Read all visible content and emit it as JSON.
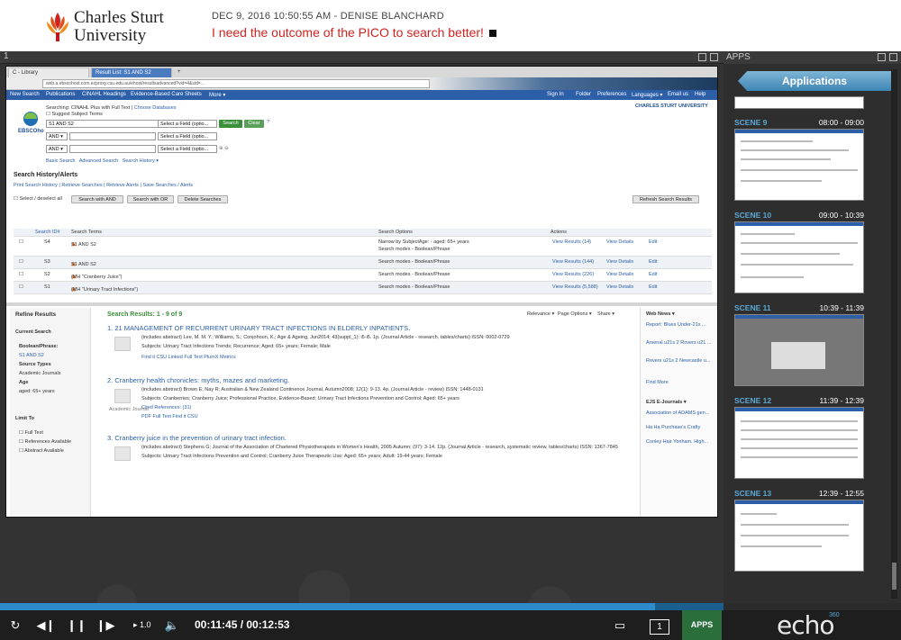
{
  "header": {
    "logo_line1": "Charles Sturt",
    "logo_line2": "University",
    "meta": "DEC 9, 2016 10:50:55 AM - DENISE BLANCHARD",
    "message": "I need the outcome of the PICO to search better!"
  },
  "stage": {
    "number": "1",
    "browser": {
      "tabs": [
        "C - Library",
        "Result List: S1 AND S2",
        "+"
      ],
      "address": "web.a.ebscohost.com.ezproxy.csu.edu.au/ehost/resultsadvanced?vid=4&sid=..."
    },
    "ebsco_nav": [
      "New Search",
      "Publications",
      "CINAHL Headings",
      "Evidence-Based Care Sheets",
      "More ▾"
    ],
    "ebsco_nav_right": [
      "Sign In",
      "Folder",
      "Preferences",
      "Languages ▾",
      "Email us",
      "Help"
    ],
    "searching_label": "Searching: CINAHL Plus with Full Text",
    "choose_databases": "Choose Databases",
    "suggest": "Suggest Subject Terms",
    "institution": "CHARLES STURT UNIVERSITY",
    "query1": "S1 AND S2",
    "field_placeholder": "Select a Field (optio...",
    "and_op": "AND ▾",
    "search_btn": "Search",
    "clear_btn": "Clear",
    "basic_search": "Basic Search",
    "advanced_search": "Advanced Search",
    "search_history": "Search History ▾",
    "history_title": "Search History/Alerts",
    "history_links": [
      "Print Search History",
      "Retrieve Searches",
      "Retrieve Alerts",
      "Save Searches / Alerts"
    ],
    "select_all": "Select / deselect all",
    "hist_buttons": [
      "Search with AND",
      "Search with OR",
      "Delete Searches",
      "Refresh Search Results"
    ],
    "hist_headers": [
      "Search ID#",
      "Search Terms",
      "Search Options",
      "Actions"
    ],
    "hist_rows": [
      {
        "id": "S4",
        "terms": "S1 AND S2",
        "options": "Narrow by SubjectAge: - aged: 65+ years",
        "options2": "Search modes - Boolean/Phrase",
        "count": "View Results (14)"
      },
      {
        "id": "S3",
        "terms": "S1 AND S2",
        "options": "Search modes - Boolean/Phrase",
        "options2": "",
        "count": "View Results (144)"
      },
      {
        "id": "S2",
        "terms": "(MH \"Cranberry Juice\")",
        "options": "Search modes - Boolean/Phrase",
        "options2": "",
        "count": "View Results (226)"
      },
      {
        "id": "S1",
        "terms": "(MH \"Urinary Tract Infections\")",
        "options": "Search modes - Boolean/Phrase",
        "options2": "",
        "count": "View Results (5,588)"
      }
    ],
    "view_details": "View Details",
    "edit": "Edit",
    "refine": {
      "title": "Refine Results",
      "current": "Current Search",
      "boolean": "Boolean/Phrase:",
      "query": "S1 AND S2",
      "source_types": "Source Types",
      "academic": "Academic Journals",
      "age": "Age",
      "aged": "aged: 65+ years",
      "limit": "Limit To",
      "full_text": "Full Text",
      "refs": "References Available",
      "abstract": "Abstract Available"
    },
    "results_heading": "Search Results: 1 - 9 of 9",
    "results_tools": [
      "Relevance ▾",
      "Page Options ▾",
      "Share ▾"
    ],
    "results": [
      {
        "num": "1.",
        "title": "21 MANAGEMENT OF RECURRENT URINARY TRACT INFECTIONS IN ELDERLY INPATIENTS.",
        "line1": "(includes abstract) Lee, M. M. Y.; Williams, S.; Conjohoun, K.; Age & Ageing, Jun2014; 43(suppl_1): i5-i5. 1p. (Journal Article - research, tables/charts) ISSN: 0002-0729",
        "line2": "Subjects: Urinary Tract Infections Trends; Recurrence; Aged: 65+ years; Female; Male",
        "links": "Find it CSU    Linked Full Text    PlumX Metrics"
      },
      {
        "num": "2.",
        "title": "Cranberry health chronicles: myths, mazes and marketing.",
        "line1": "(includes abstract) Brown E; Nay R; Australian & New Zealand Continence Journal, Autumn2008; 12(1): 9-13. 4p. (Journal Article - review) ISSN: 1448-0131",
        "line2": "Subjects: Cranberries; Cranberry Juice; Professional Practice, Evidence-Based; Urinary Tract Infections Prevention and Control; Aged: 65+ years",
        "links": "PDF Full Text    Find it CSU"
      },
      {
        "num": "3.",
        "title": "Cranberry juice in the prevention of urinary tract infection.",
        "line1": "(includes abstract) Stephens G; Journal of the Association of Chartered Physiotherapists in Women's Health, 2005 Autumn; (97): 3-14. 12p. (Journal Article - research, systematic review, tables/charts) ISSN: 1367-7845",
        "line2": "Subjects: Urinary Tract Infections Prevention and Control; Cranberry Juice Therapeutic Use; Aged: 65+ years; Adult: 19-44 years; Female",
        "links": ""
      }
    ],
    "cited_refs": "Cited References: (31)",
    "academic_journal": "Academic Journal",
    "web_news": "Web News ▾",
    "news": [
      "Report: Blues Under-21s ...",
      "Arsenal u21s 2 Rovers u21 ...",
      "Rovers u21s 2 Newcastle u...",
      "Find More"
    ],
    "ejs": "EJS E-Journals ▾",
    "ejs_items": [
      "Association of ADAMS gen...",
      "Ha Ha Purchase's Crafty",
      "Conley Hair Yonham, High..."
    ]
  },
  "apps": {
    "bar_title": "APPS",
    "button": "Applications",
    "scenes": [
      {
        "name": "SCENE 9",
        "time": "08:00 - 09:00"
      },
      {
        "name": "SCENE 10",
        "time": "09:00 - 10:39"
      },
      {
        "name": "SCENE 11",
        "time": "10:39 - 11:39"
      },
      {
        "name": "SCENE 12",
        "time": "11:39 - 12:39"
      },
      {
        "name": "SCENE 13",
        "time": "12:39 - 12:55"
      }
    ]
  },
  "player": {
    "progress_fraction": 0.905,
    "speed": "1.0",
    "time": "00:11:45 / 00:12:53",
    "slide_num": "1",
    "apps_label": "APPS",
    "brand": "echo",
    "brand_sup": "360"
  },
  "colors": {
    "accent": "#2e8bcb",
    "ebsco_blue": "#2c5fa8",
    "message_red": "#d0231f",
    "apps_green": "#2a6e3c"
  }
}
